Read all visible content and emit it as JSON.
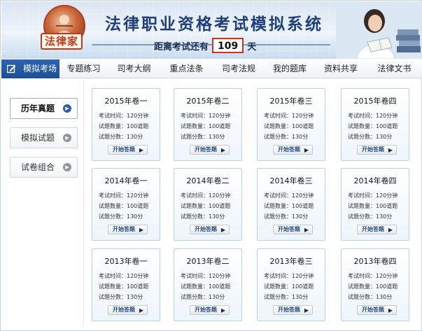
{
  "banner": {
    "logo_text": "法律家",
    "title": "法律职业资格考试模拟系统",
    "countdown_prefix": "距离考试还有",
    "countdown_days": "109",
    "countdown_suffix": "天"
  },
  "nav": {
    "items": [
      {
        "label": "模拟考场",
        "active": true
      },
      {
        "label": "专题练习"
      },
      {
        "label": "司考大纲"
      },
      {
        "label": "重点法条"
      },
      {
        "label": "司考法规"
      },
      {
        "label": "我的题库"
      },
      {
        "label": "资料共享"
      },
      {
        "label": "法律文书"
      }
    ]
  },
  "sidebar": {
    "items": [
      {
        "label": "历年真题",
        "active": true
      },
      {
        "label": "模拟试题"
      },
      {
        "label": "试卷组合"
      }
    ]
  },
  "papers": [
    {
      "title": "2015年卷一",
      "time": "考试时间：120分钟",
      "count": "试题数量：100道题",
      "score": "试题分数：130分",
      "button": "开始答题"
    },
    {
      "title": "2015年卷二",
      "time": "考试时间：120分钟",
      "count": "试题数量：100道题",
      "score": "试题分数：130分",
      "button": "开始答题"
    },
    {
      "title": "2015年卷三",
      "time": "考试时间：120分钟",
      "count": "试题数量：100道题",
      "score": "试题分数：130分",
      "button": "开始答题"
    },
    {
      "title": "2015年卷四",
      "time": "考试时间：120分钟",
      "count": "试题数量：100道题",
      "score": "试题分数：130分",
      "button": "开始答题"
    },
    {
      "title": "2014年卷一",
      "time": "考试时间：120分钟",
      "count": "试题数量：100道题",
      "score": "试题分数：130分",
      "button": "开始答题"
    },
    {
      "title": "2014年卷二",
      "time": "考试时间：120分钟",
      "count": "试题数量：100道题",
      "score": "试题分数：130分",
      "button": "开始答题"
    },
    {
      "title": "2014年卷三",
      "time": "考试时间：120分钟",
      "count": "试题数量：100道题",
      "score": "试题分数：130分",
      "button": "开始答题"
    },
    {
      "title": "2014年卷四",
      "time": "考试时间：120分钟",
      "count": "试题数量：100道题",
      "score": "试题分数：130分",
      "button": "开始答题"
    },
    {
      "title": "2013年卷一",
      "time": "考试时间：120分钟",
      "count": "试题数量：100道题",
      "score": "试题分数：130分",
      "button": "开始答题"
    },
    {
      "title": "2013年卷二",
      "time": "考试时间：120分钟",
      "count": "试题数量：100道题",
      "score": "试题分数：130分",
      "button": "开始答题"
    },
    {
      "title": "2013年卷三",
      "time": "考试时间：120分钟",
      "count": "试题数量：100道题",
      "score": "试题分数：130分",
      "button": "开始答题"
    },
    {
      "title": "2013年卷四",
      "time": "考试时间：120分钟",
      "count": "试题数量：100道题",
      "score": "试题分数：130分",
      "button": "开始答题"
    }
  ],
  "colors": {
    "brand_blue": "#1e3f7c",
    "nav_active": "#2b63b3",
    "logo_red": "#c2381f"
  }
}
